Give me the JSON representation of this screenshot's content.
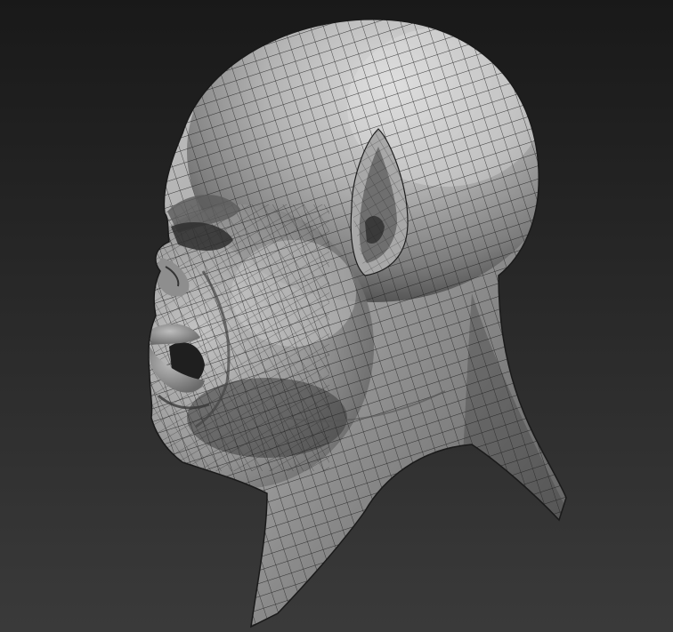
{
  "scene": {
    "subject": "sculpted-head-wireframe",
    "view": "left-profile",
    "colors": {
      "background_top": "#1c1c1c",
      "background_bottom": "#3b3b3b",
      "skin_light": "#d6d6d6",
      "skin_mid": "#9a9a9a",
      "skin_dark": "#4a4a4a",
      "wire": "#1e1e1e"
    }
  }
}
